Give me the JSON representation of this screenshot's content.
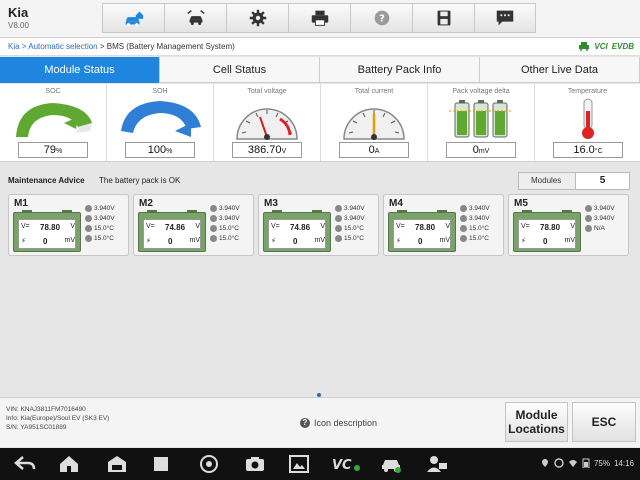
{
  "app": {
    "brand": "Kia",
    "version": "V8.00"
  },
  "toolbar": {
    "buttons": [
      {
        "name": "home-car-icon"
      },
      {
        "name": "vehicle-swap-icon"
      },
      {
        "name": "gear-icon"
      },
      {
        "name": "printer-icon"
      },
      {
        "name": "help-icon"
      },
      {
        "name": "save-icon"
      },
      {
        "name": "message-icon"
      }
    ]
  },
  "breadcrumb": {
    "link1": "Kia",
    "sep1": " > ",
    "link2": "Automatic selection",
    "sep2": " > ",
    "current": "BMS (Battery Management System)",
    "icons": {
      "vci": "VCI",
      "evdb": "EVDB"
    }
  },
  "tabs": [
    {
      "label": "Module Status",
      "active": true
    },
    {
      "label": "Cell Status",
      "active": false
    },
    {
      "label": "Battery Pack Info",
      "active": false
    },
    {
      "label": "Other Live Data",
      "active": false
    }
  ],
  "gauges": [
    {
      "label": "SOC",
      "value": "79",
      "unit": "%"
    },
    {
      "label": "SOH",
      "value": "100",
      "unit": "%"
    },
    {
      "label": "Total voltage",
      "value": "386.70",
      "unit": "V"
    },
    {
      "label": "Total current",
      "value": "0",
      "unit": "A"
    },
    {
      "label": "Pack voltage delta",
      "value": "0",
      "unit": "mV"
    },
    {
      "label": "Temperature",
      "value": "16.0",
      "unit": "°C"
    }
  ],
  "maintenance": {
    "label": "Maintenance Advice",
    "message": "The battery pack is OK"
  },
  "modules_count": {
    "label": "Modules",
    "value": "5"
  },
  "modules": [
    {
      "id": "M1",
      "voltage": "78.80",
      "vunit": "V",
      "current": "0",
      "aunit": "mV",
      "stats": [
        "3.940V",
        "3.940V",
        "15.0°C",
        "15.0°C"
      ]
    },
    {
      "id": "M2",
      "voltage": "74.86",
      "vunit": "V",
      "current": "0",
      "aunit": "mV",
      "stats": [
        "3.940V",
        "3.940V",
        "15.0°C",
        "15.0°C"
      ]
    },
    {
      "id": "M3",
      "voltage": "74.86",
      "vunit": "V",
      "current": "0",
      "aunit": "mV",
      "stats": [
        "3.940V",
        "3.940V",
        "15.0°C",
        "15.0°C"
      ]
    },
    {
      "id": "M4",
      "voltage": "78.80",
      "vunit": "V",
      "current": "0",
      "aunit": "mV",
      "stats": [
        "3.940V",
        "3.940V",
        "15.0°C",
        "15.0°C"
      ]
    },
    {
      "id": "M5",
      "voltage": "78.80",
      "vunit": "V",
      "current": "0",
      "aunit": "mV",
      "stats": [
        "3.940V",
        "3.940V",
        "N/A"
      ]
    }
  ],
  "vehicle_info": {
    "vin": "VIN: KNAJ3811FM7016490",
    "info": "Info: Kia(Europe)/Soul EV (SK3 EV)",
    "sn": "S/N: YA951SC01889"
  },
  "icon_description": "Icon description",
  "buttons": {
    "module_locations": "Module Locations",
    "esc": "ESC"
  },
  "status_bar": {
    "battery": "75%",
    "time": "14:16"
  },
  "colors": {
    "accent": "#1f86e0",
    "soc": "#5fa832",
    "soh": "#2f7fd6"
  }
}
